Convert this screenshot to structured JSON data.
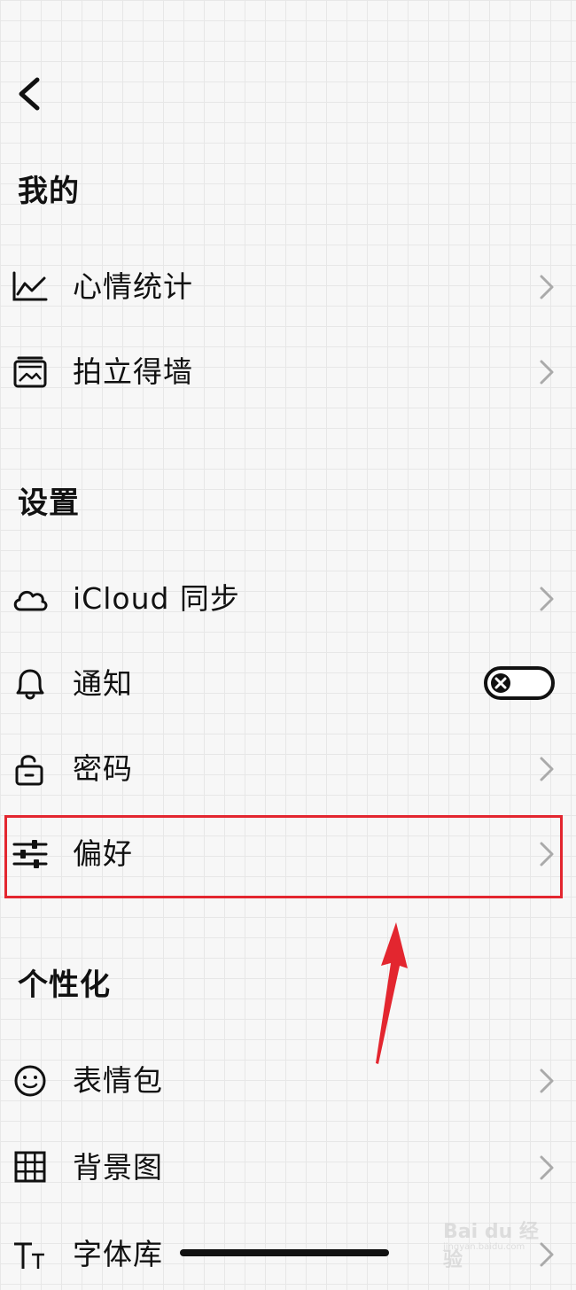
{
  "sections": {
    "mine": {
      "title": "我的",
      "items": [
        {
          "label": "心情统计",
          "icon": "chart-line-icon"
        },
        {
          "label": "拍立得墙",
          "icon": "photo-wall-icon"
        }
      ]
    },
    "settings": {
      "title": "设置",
      "items": [
        {
          "label": "iCloud 同步",
          "icon": "cloud-icon"
        },
        {
          "label": "通知",
          "icon": "bell-icon",
          "toggle_on": false
        },
        {
          "label": "密码",
          "icon": "lock-icon"
        },
        {
          "label": "偏好",
          "icon": "sliders-icon",
          "highlighted": true
        }
      ]
    },
    "personalize": {
      "title": "个性化",
      "items": [
        {
          "label": "表情包",
          "icon": "smiley-icon"
        },
        {
          "label": "背景图",
          "icon": "grid-icon"
        },
        {
          "label": "字体库",
          "icon": "font-icon"
        }
      ]
    }
  },
  "annotation": {
    "highlight_color": "#e3262f"
  },
  "watermark": {
    "text": "Bai du 经验",
    "sub": "jingyan.baidu.com"
  }
}
